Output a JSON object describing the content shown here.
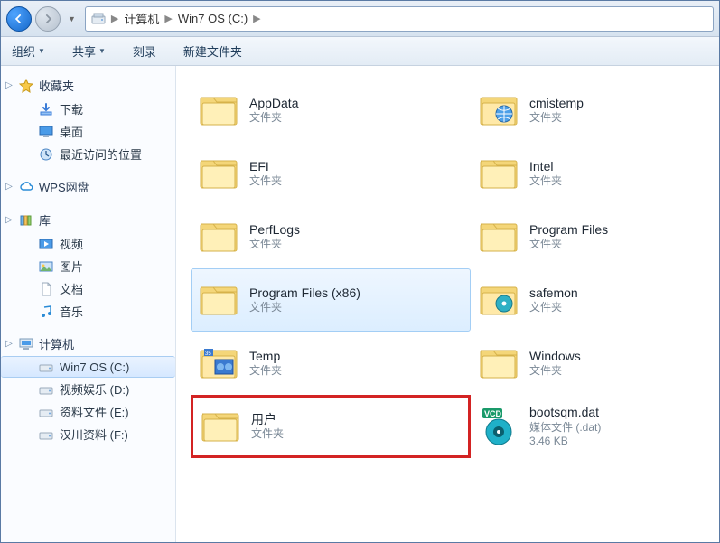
{
  "breadcrumb": {
    "root_icon": "drive-icon",
    "items": [
      "计算机",
      "Win7 OS (C:)"
    ]
  },
  "toolbar": {
    "organize": "组织",
    "share": "共享",
    "burn": "刻录",
    "new_folder": "新建文件夹"
  },
  "sidebar": {
    "favorites": {
      "label": "收藏夹",
      "items": [
        {
          "icon": "download-icon",
          "label": "下载"
        },
        {
          "icon": "desktop-icon",
          "label": "桌面"
        },
        {
          "icon": "recent-icon",
          "label": "最近访问的位置"
        }
      ]
    },
    "wps": {
      "icon": "cloud-icon",
      "label": "WPS网盘"
    },
    "libraries": {
      "label": "库",
      "items": [
        {
          "icon": "video-icon",
          "label": "视频"
        },
        {
          "icon": "picture-icon",
          "label": "图片"
        },
        {
          "icon": "document-icon",
          "label": "文档"
        },
        {
          "icon": "music-icon",
          "label": "音乐"
        }
      ]
    },
    "computer": {
      "label": "计算机",
      "items": [
        {
          "icon": "drive-icon",
          "label": "Win7 OS (C:)",
          "selected": true
        },
        {
          "icon": "disc-icon",
          "label": "视频娱乐 (D:)"
        },
        {
          "icon": "disc-icon",
          "label": "资料文件 (E:)"
        },
        {
          "icon": "disc-icon",
          "label": "汉川资料 (F:)"
        }
      ]
    }
  },
  "content": {
    "type_label_folder": "文件夹",
    "items": [
      {
        "name": "AppData",
        "type": "文件夹",
        "icon": "folder"
      },
      {
        "name": "cmistemp",
        "type": "文件夹",
        "icon": "folder-globe"
      },
      {
        "name": "EFI",
        "type": "文件夹",
        "icon": "folder"
      },
      {
        "name": "Intel",
        "type": "文件夹",
        "icon": "folder"
      },
      {
        "name": "PerfLogs",
        "type": "文件夹",
        "icon": "folder"
      },
      {
        "name": "Program Files",
        "type": "文件夹",
        "icon": "folder"
      },
      {
        "name": "Program Files (x86)",
        "type": "文件夹",
        "icon": "folder",
        "selected": true
      },
      {
        "name": "safemon",
        "type": "文件夹",
        "icon": "folder-disc"
      },
      {
        "name": "Temp",
        "type": "文件夹",
        "icon": "folder-video"
      },
      {
        "name": "Windows",
        "type": "文件夹",
        "icon": "folder"
      },
      {
        "name": "用户",
        "type": "文件夹",
        "icon": "folder",
        "highlighted": true
      },
      {
        "name": "bootsqm.dat",
        "type": "媒体文件 (.dat)",
        "size": "3.46 KB",
        "icon": "vcd"
      }
    ]
  }
}
